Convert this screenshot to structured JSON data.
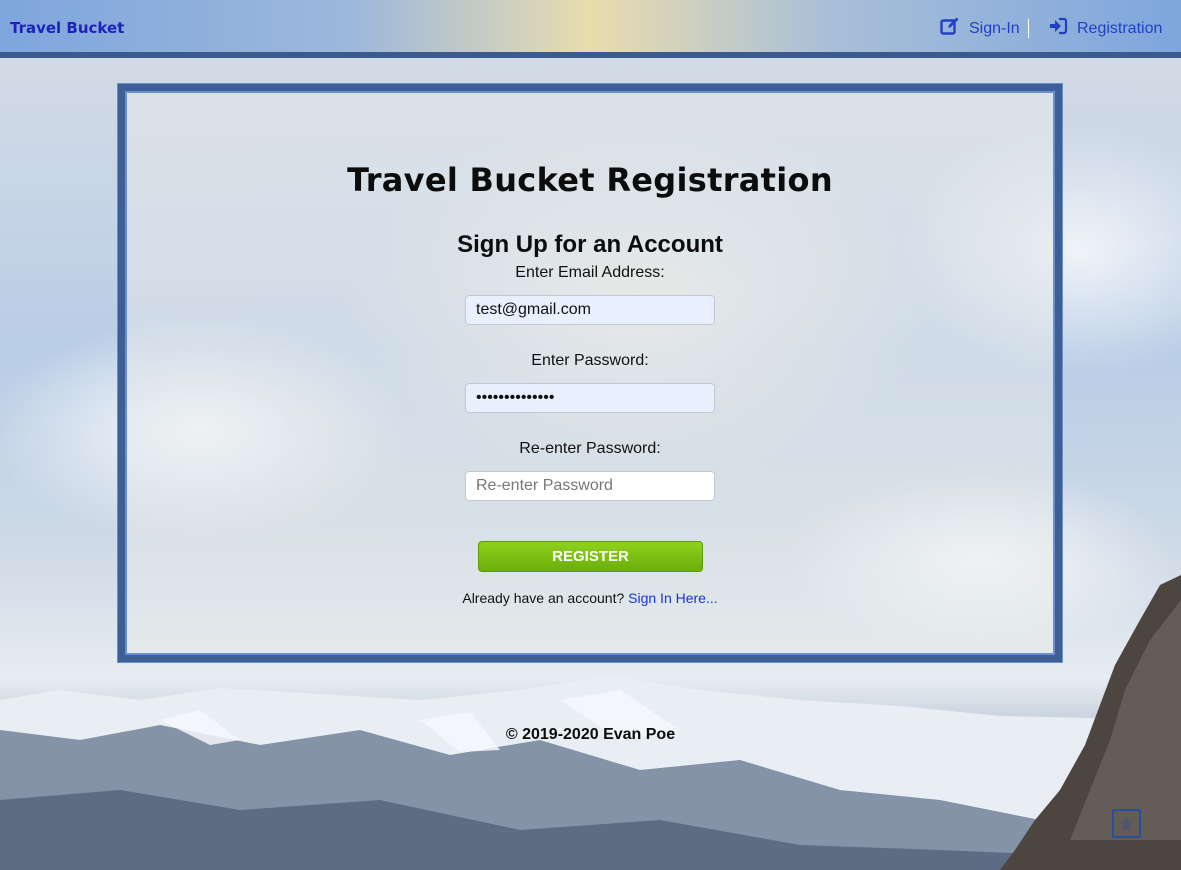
{
  "navbar": {
    "brand": "Travel Bucket",
    "links": [
      {
        "label": "Sign-In",
        "icon": "edit-icon"
      },
      {
        "label": "Registration",
        "icon": "sign-in-arrow-icon"
      }
    ]
  },
  "panel": {
    "title": "Travel Bucket Registration",
    "form_title": "Sign Up for an Account",
    "email": {
      "label": "Enter Email Address:",
      "value": "test@gmail.com"
    },
    "password": {
      "label": "Enter Password:",
      "value": "••••••••••••••"
    },
    "reenter_password": {
      "label": "Re-enter Password:",
      "value": "",
      "placeholder": "Re-enter Password"
    },
    "register_button": "REGISTER",
    "signin_prompt": "Already have an account?",
    "signin_link": "Sign In Here..."
  },
  "footer": {
    "copyright": "© 2019-2020 Evan Poe"
  },
  "colors": {
    "accent": "#3d5f96",
    "button": "#7cc014",
    "link": "#1a33d6"
  }
}
